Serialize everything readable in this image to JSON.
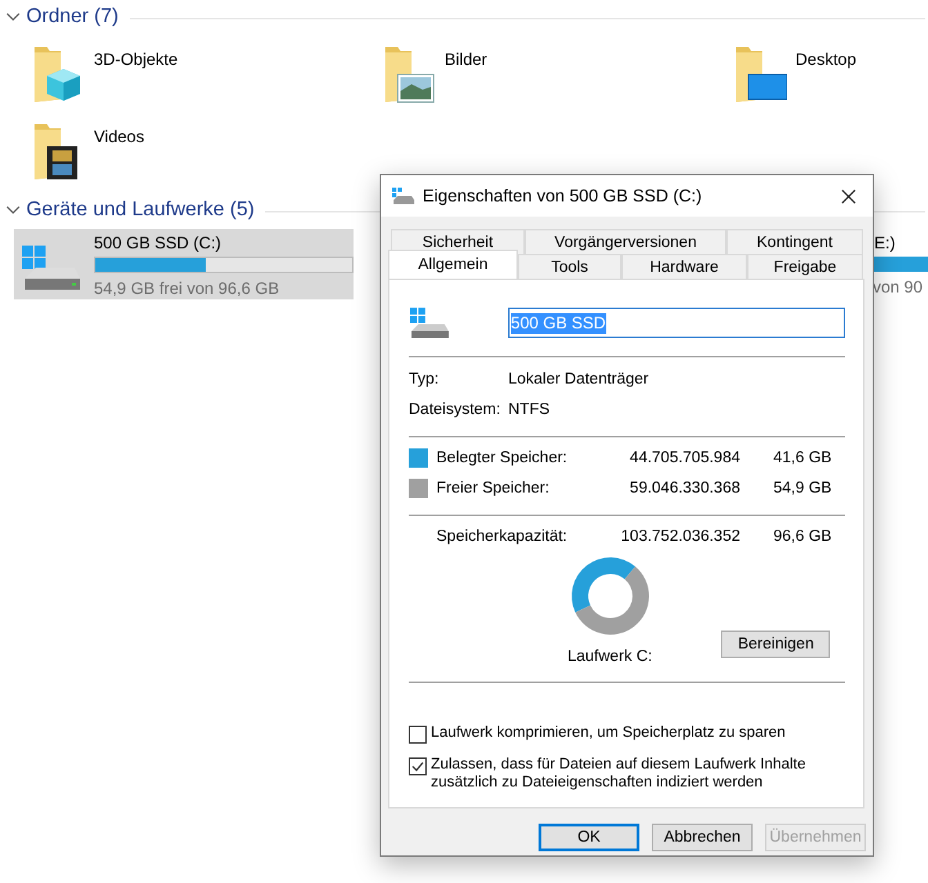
{
  "sections": [
    {
      "title": "Ordner (7)"
    },
    {
      "title": "Geräte und Laufwerke (5)"
    }
  ],
  "folders": [
    {
      "name": "3D-Objekte",
      "kind": "objects"
    },
    {
      "name": "Bilder",
      "kind": "pictures"
    },
    {
      "name": "Desktop",
      "kind": "desktop"
    },
    {
      "name": "Videos",
      "kind": "videos"
    }
  ],
  "drives": [
    {
      "name": "500 GB SSD (C:)",
      "free": "54,9 GB frei von 96,6 GB",
      "level": 0.43,
      "selected": true
    },
    {
      "name": "E:)",
      "free": "von 90",
      "selected": false
    }
  ],
  "dialog": {
    "title": "Eigenschaften von 500 GB SSD (C:)",
    "tab_rows": [
      [
        {
          "label": "Sicherheit",
          "selected": false
        },
        {
          "label": "Vorgängerversionen",
          "selected": false
        },
        {
          "label": "Kontingent",
          "selected": false
        }
      ],
      [
        {
          "label": "Allgemein",
          "selected": true
        },
        {
          "label": "Tools",
          "selected": false
        },
        {
          "label": "Hardware",
          "selected": false
        },
        {
          "label": "Freigabe",
          "selected": false
        }
      ]
    ],
    "name_value": "500 GB SSD",
    "info": [
      {
        "label": "Typ:",
        "value": "Lokaler Datenträger"
      },
      {
        "label": "Dateisystem:",
        "value": "NTFS"
      }
    ],
    "usage": [
      {
        "label": "Belegter Speicher:",
        "bytes": "44.705.705.984",
        "size": "41,6 GB",
        "color": "#26a0da"
      },
      {
        "label": "Freier Speicher:",
        "bytes": "59.046.330.368",
        "size": "54,9 GB",
        "color": "#a0a0a0"
      }
    ],
    "capacity": {
      "label": "Speicherkapazität:",
      "bytes": "103.752.036.352",
      "size": "96,6 GB"
    },
    "chart_data": {
      "type": "donut",
      "values": [
        43.1,
        56.9
      ]
    },
    "drive_label": "Laufwerk C:",
    "cleanup_button": "Bereinigen",
    "options": [
      {
        "label": "Laufwerk komprimieren, um Speicherplatz zu sparen",
        "checked": false
      },
      {
        "label": "Zulassen, dass für Dateien auf diesem Laufwerk Inhalte zusätzlich zu Dateieigenschaften indiziert werden",
        "checked": true
      }
    ],
    "buttons": [
      {
        "label": "OK",
        "kind": "default"
      },
      {
        "label": "Abbrechen",
        "kind": "normal"
      },
      {
        "label": "Übernehmen",
        "kind": "disabled"
      }
    ]
  }
}
